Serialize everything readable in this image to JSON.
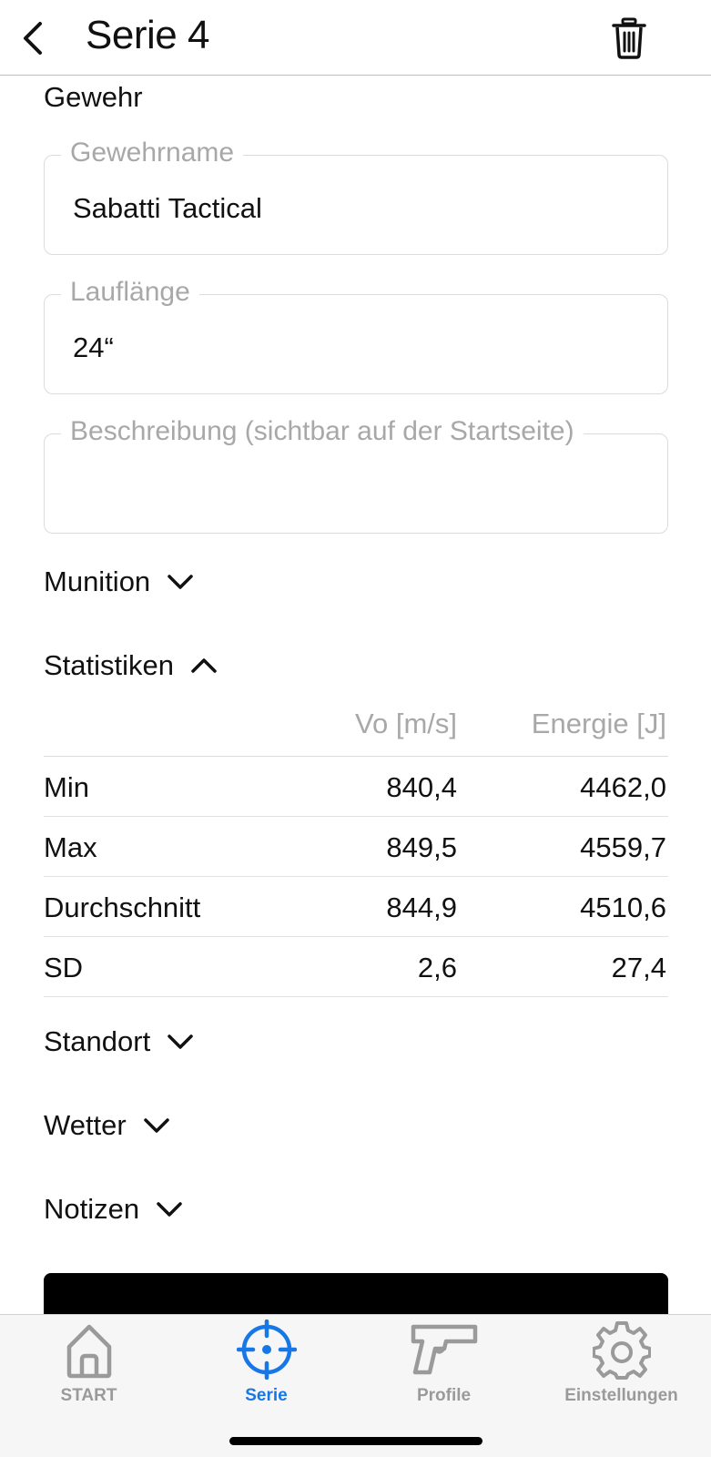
{
  "header": {
    "title": "Serie 4"
  },
  "gewehr": {
    "heading": "Gewehr",
    "fields": [
      {
        "label": "Gewehrname",
        "value": "Sabatti Tactical"
      },
      {
        "label": "Lauflänge",
        "value": "24“"
      },
      {
        "label": "Beschreibung (sichtbar auf der Startseite)",
        "value": ""
      }
    ]
  },
  "sections": {
    "munition": "Munition",
    "statistiken": "Statistiken",
    "standort": "Standort",
    "wetter": "Wetter",
    "notizen": "Notizen"
  },
  "stats": {
    "columns": [
      "Vo [m/s]",
      "Energie [J]"
    ],
    "rows": [
      {
        "name": "Min",
        "vo": "840,4",
        "energie": "4462,0"
      },
      {
        "name": "Max",
        "vo": "849,5",
        "energie": "4559,7"
      },
      {
        "name": "Durchschnitt",
        "vo": "844,9",
        "energie": "4510,6"
      },
      {
        "name": "SD",
        "vo": "2,6",
        "energie": "27,4"
      }
    ]
  },
  "tabbar": {
    "active": "Serie",
    "accent_color": "#1877e6",
    "inactive_color": "#9a9a9a",
    "tabs": [
      {
        "label": "START",
        "icon": "home-icon"
      },
      {
        "label": "Serie",
        "icon": "crosshair-icon"
      },
      {
        "label": "Profile",
        "icon": "pistol-icon"
      },
      {
        "label": "Einstellungen",
        "icon": "gear-icon"
      }
    ]
  }
}
